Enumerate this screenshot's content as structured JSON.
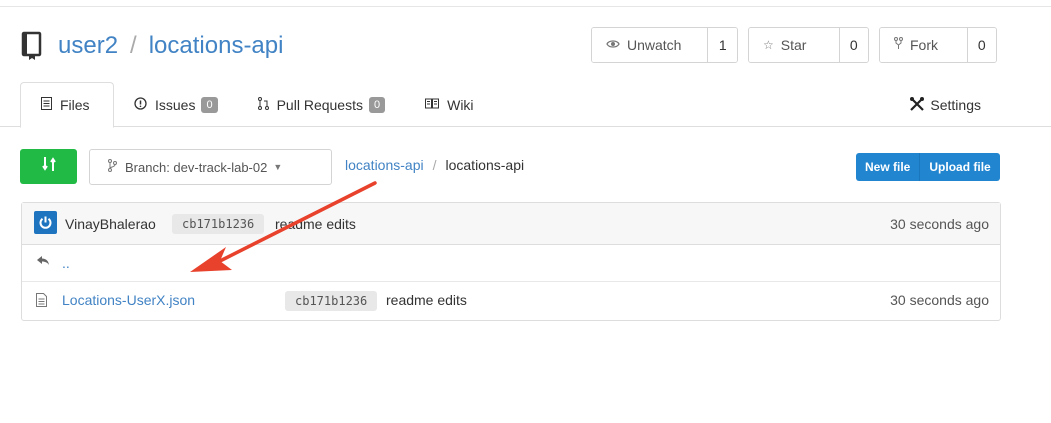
{
  "repo": {
    "owner": "user2",
    "separator": "/",
    "name": "locations-api"
  },
  "watch": {
    "label": "Unwatch",
    "count": "1"
  },
  "star": {
    "label": "Star",
    "count": "0"
  },
  "fork": {
    "label": "Fork",
    "count": "0"
  },
  "tabs": [
    {
      "label": "Files",
      "icon": "file-text-icon"
    },
    {
      "label": "Issues",
      "icon": "issue-icon",
      "badge": "0"
    },
    {
      "label": "Pull Requests",
      "icon": "pull-request-icon",
      "badge": "0"
    },
    {
      "label": "Wiki",
      "icon": "book-icon"
    }
  ],
  "settings_label": "Settings",
  "branch": {
    "label": "Branch: dev-track-lab-02"
  },
  "breadcrumb": {
    "root": "locations-api",
    "sep": "/",
    "current": "locations-api"
  },
  "actions": {
    "new_file": "New file",
    "upload_file": "Upload file"
  },
  "latest_commit": {
    "author": "VinayBhalerao",
    "sha": "cb171b1236",
    "message": "readme edits",
    "age": "30 seconds ago"
  },
  "parent_link": "..",
  "files": [
    {
      "name": "Locations-UserX.json",
      "sha": "cb171b1236",
      "message": "readme edits",
      "age": "30 seconds ago"
    }
  ],
  "colors": {
    "link": "#4183c4",
    "green": "#21ba45",
    "blue": "#2185d0",
    "arrow": "#e8412c"
  }
}
